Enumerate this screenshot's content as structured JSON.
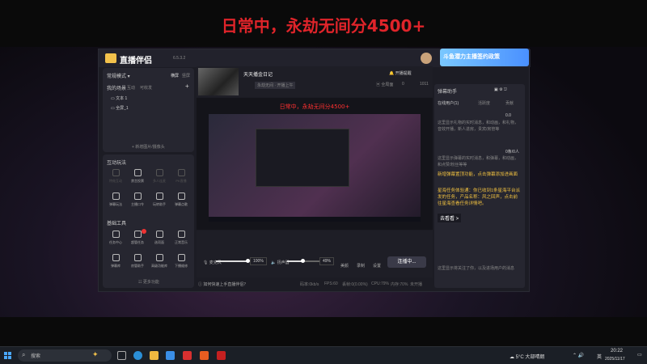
{
  "overlay": {
    "top_text": "日常中，永劫无间分4500+"
  },
  "app": {
    "name": "直播伴侣",
    "version": "6.5.3.2",
    "promo": "斗鱼潜力主播签约政策"
  },
  "scene_panel": {
    "mode": "常规模式",
    "orientation_h": "横屏",
    "orientation_v": "竖屏",
    "tabs": [
      "我的场景",
      "互动",
      "可收发"
    ],
    "scenes": [
      "文本 1",
      "全屏_1"
    ],
    "new_scene": "+ 新增图片/摄像头"
  },
  "interaction": {
    "title": "互动玩法",
    "tools": [
      {
        "label": "特效互动",
        "icon": "fx-icon",
        "enabled": false
      },
      {
        "label": "禁言投票",
        "icon": "shield-icon",
        "enabled": true
      },
      {
        "label": "多人连麦",
        "icon": "multi-user-icon",
        "enabled": false
      },
      {
        "label": "PK直播",
        "icon": "user-add-icon",
        "enabled": false
      },
      {
        "label": "弹幕玩法",
        "icon": "download-icon",
        "enabled": true
      },
      {
        "label": "主播口令",
        "icon": "command-icon",
        "enabled": true
      },
      {
        "label": "玩转助手",
        "icon": "assistant-icon",
        "enabled": true
      },
      {
        "label": "弹幕点歌",
        "icon": "music-icon",
        "enabled": true
      }
    ]
  },
  "basic_tools": {
    "title": "基础工具",
    "tools": [
      {
        "label": "任务中心",
        "icon": "checklist-icon"
      },
      {
        "label": "超管任务",
        "icon": "ad-icon",
        "badge": "1"
      },
      {
        "label": "选项面",
        "icon": "slides-icon"
      },
      {
        "label": "正常音乐",
        "icon": "download-icon"
      },
      {
        "label": "弹幕库",
        "icon": "library-icon"
      },
      {
        "label": "房管助手",
        "icon": "manager-icon"
      },
      {
        "label": "高级功能库",
        "icon": "advanced-icon"
      },
      {
        "label": "下播维修",
        "icon": "wrench-icon"
      }
    ],
    "more": "更多功能"
  },
  "stream": {
    "title": "天天播金日记",
    "category": "永劫无间 · 开播上午",
    "badge": "全局面",
    "likes": "0",
    "viewers": "1011",
    "schedule": "开播提醒",
    "caption": "日常中，永劫无间分4500+"
  },
  "controls": {
    "mic_label": "麦克风",
    "mic_value": "100%",
    "mic_level": 1.0,
    "speaker_label": "扬声器",
    "speaker_value": "49%",
    "speaker_level": 0.49,
    "beauty": "美颜",
    "record": "录制",
    "settings": "设置",
    "live_button": "连播中..."
  },
  "statusbar": {
    "tip": "如何快速上手直播伴侣？",
    "bitrate": "码率:0kb/s",
    "fps": "FPS:60",
    "lost": "丢帧:0(0.00%)",
    "cpu": "CPU:79%",
    "mem": "内存:70%",
    "net": "未开播"
  },
  "chat_panel": {
    "title": "弹幕助手",
    "tabs": [
      "在线用户(1)",
      "活跃度",
      "贡献"
    ],
    "likes": "0.0",
    "tip1": "这里显示礼物的实时消息，和动画，和礼物，音效开播，新人进房，贵宾/房管等",
    "count": "0条/0人",
    "tip2": "这里显示弹幕的实时消息，和弹幕，和动画，和点赞/粉丝等等",
    "notice1": "新增弹幕置顶功能，点击弹幕添加进画面",
    "notice2": "星海任务体验通：你已收到1条星海平台派发的任务，产品名称：风之回声，点击前往星海查看任务详情吧。",
    "link": "去看看 >",
    "tip3": "这里显示将关注了你，以及进场用户的消息"
  },
  "taskbar": {
    "search": "搜索",
    "weather": "5°C 大部晴朗",
    "lang": "英",
    "time": "20:22",
    "date": "2025/11/17"
  },
  "colors": {
    "accent_red": "#e0242a",
    "promo_blue": "#4a90ff",
    "notice_yellow": "#f0c040"
  }
}
